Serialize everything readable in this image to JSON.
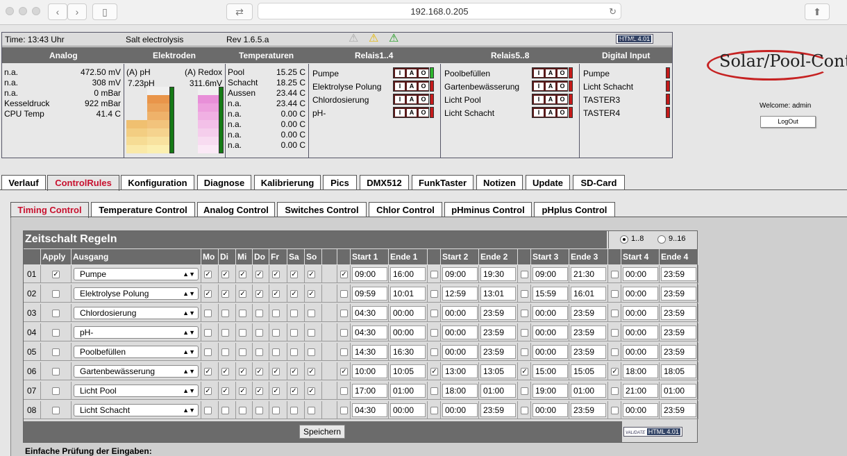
{
  "browser": {
    "url": "192.168.0.205"
  },
  "topbar": {
    "time": "Time: 13:43 Uhr",
    "mode": "Salt electrolysis",
    "rev": "Rev 1.6.5.a",
    "valid_text": "HTML 4.01",
    "valid_prefix": "VALIDATE"
  },
  "headers": [
    "Analog",
    "Elektroden",
    "Temperaturen",
    "Relais1..4",
    "Relais5..8",
    "Digital Input"
  ],
  "analog": [
    {
      "label": "n.a.",
      "value": "472.50 mV"
    },
    {
      "label": "n.a.",
      "value": "308 mV"
    },
    {
      "label": "n.a.",
      "value": "0 mBar"
    },
    {
      "label": "Kesseldruck",
      "value": "922 mBar"
    },
    {
      "label": "CPU Temp",
      "value": "41.4 C"
    }
  ],
  "elektroden": {
    "ph_label": "(A) pH",
    "redox_label": "(A) Redox",
    "ph_value": "7.23pH",
    "redox_value": "311.6mV"
  },
  "temperaturen": [
    {
      "label": "Pool",
      "value": "15.25 C"
    },
    {
      "label": "Schacht",
      "value": "18.25 C"
    },
    {
      "label": "Aussen",
      "value": "23.44 C"
    },
    {
      "label": "n.a.",
      "value": "23.44 C"
    },
    {
      "label": "n.a.",
      "value": "0.00 C"
    },
    {
      "label": "n.a.",
      "value": "0.00 C"
    },
    {
      "label": "n.a.",
      "value": "0.00 C"
    },
    {
      "label": "n.a.",
      "value": "0.00 C"
    }
  ],
  "relais1": [
    {
      "label": "Pumpe",
      "on": true
    },
    {
      "label": "Elektrolyse Polung",
      "on": false
    },
    {
      "label": "Chlordosierung",
      "on": false
    },
    {
      "label": "pH-",
      "on": false
    }
  ],
  "relais2": [
    {
      "label": "Poolbefüllen",
      "on": false
    },
    {
      "label": "Gartenbewässerung",
      "on": false
    },
    {
      "label": "Licht Pool",
      "on": false
    },
    {
      "label": "Licht Schacht",
      "on": false
    }
  ],
  "iao": [
    "I",
    "A",
    "O"
  ],
  "digital": [
    "Pumpe",
    "Licht Schacht",
    "TASTER3",
    "TASTER4"
  ],
  "logo": "Solar/Pool-Contr",
  "welcome": "Welcome:  admin",
  "logout": "LogOut",
  "main_tabs": [
    "Verlauf",
    "ControlRules",
    "Konfiguration",
    "Diagnose",
    "Kalibrierung",
    "Pics",
    "DMX512",
    "FunkTaster",
    "Notizen",
    "Update",
    "SD-Card"
  ],
  "sub_tabs": [
    "Timing Control",
    "Temperature Control",
    "Analog Control",
    "Switches Control",
    "Chlor Control",
    "pHminus Control",
    "pHplus Control"
  ],
  "schedule": {
    "title": "Zeitschalt Regeln",
    "range1": "1..8",
    "range2": "9..16",
    "cols": {
      "apply": "Apply",
      "ausgang": "Ausgang",
      "days": [
        "Mo",
        "Di",
        "Mi",
        "Do",
        "Fr",
        "Sa",
        "So"
      ],
      "start1": "Start 1",
      "ende1": "Ende 1",
      "start2": "Start 2",
      "ende2": "Ende 2",
      "start3": "Start 3",
      "ende3": "Ende 3",
      "start4": "Start 4",
      "ende4": "Ende 4"
    },
    "rows": [
      {
        "n": "01",
        "apply": true,
        "out": "Pumpe",
        "days": [
          1,
          1,
          1,
          1,
          1,
          1,
          1
        ],
        "en": [
          1,
          0,
          0,
          0
        ],
        "t": [
          "09:00",
          "16:00",
          "09:00",
          "19:30",
          "09:00",
          "21:30",
          "00:00",
          "23:59"
        ]
      },
      {
        "n": "02",
        "apply": false,
        "out": "Elektrolyse Polung",
        "days": [
          1,
          1,
          1,
          1,
          1,
          1,
          1
        ],
        "en": [
          0,
          0,
          0,
          0
        ],
        "t": [
          "09:59",
          "10:01",
          "12:59",
          "13:01",
          "15:59",
          "16:01",
          "00:00",
          "23:59"
        ]
      },
      {
        "n": "03",
        "apply": false,
        "out": "Chlordosierung",
        "days": [
          0,
          0,
          0,
          0,
          0,
          0,
          0
        ],
        "en": [
          0,
          0,
          0,
          0
        ],
        "t": [
          "04:30",
          "00:00",
          "00:00",
          "23:59",
          "00:00",
          "23:59",
          "00:00",
          "23:59"
        ]
      },
      {
        "n": "04",
        "apply": false,
        "out": "pH-",
        "days": [
          0,
          0,
          0,
          0,
          0,
          0,
          0
        ],
        "en": [
          0,
          0,
          0,
          0
        ],
        "t": [
          "04:30",
          "00:00",
          "00:00",
          "23:59",
          "00:00",
          "23:59",
          "00:00",
          "23:59"
        ]
      },
      {
        "n": "05",
        "apply": false,
        "out": "Poolbefüllen",
        "days": [
          0,
          0,
          0,
          0,
          0,
          0,
          0
        ],
        "en": [
          0,
          0,
          0,
          0
        ],
        "t": [
          "14:30",
          "16:30",
          "00:00",
          "23:59",
          "00:00",
          "23:59",
          "00:00",
          "23:59"
        ]
      },
      {
        "n": "06",
        "apply": false,
        "out": "Gartenbewässerung",
        "days": [
          1,
          1,
          1,
          1,
          1,
          1,
          1
        ],
        "en": [
          1,
          1,
          1,
          1
        ],
        "t": [
          "10:00",
          "10:05",
          "13:00",
          "13:05",
          "15:00",
          "15:05",
          "18:00",
          "18:05"
        ]
      },
      {
        "n": "07",
        "apply": false,
        "out": "Licht Pool",
        "days": [
          1,
          1,
          1,
          1,
          1,
          1,
          1
        ],
        "en": [
          0,
          0,
          0,
          0
        ],
        "t": [
          "17:00",
          "01:00",
          "18:00",
          "01:00",
          "19:00",
          "01:00",
          "21:00",
          "01:00"
        ]
      },
      {
        "n": "08",
        "apply": false,
        "out": "Licht Schacht",
        "days": [
          0,
          0,
          0,
          0,
          0,
          0,
          0
        ],
        "en": [
          0,
          0,
          0,
          0
        ],
        "t": [
          "04:30",
          "00:00",
          "00:00",
          "23:59",
          "00:00",
          "23:59",
          "00:00",
          "23:59"
        ]
      }
    ],
    "save": "Speichern"
  },
  "hint": "Einfache Prüfung der Eingaben:"
}
